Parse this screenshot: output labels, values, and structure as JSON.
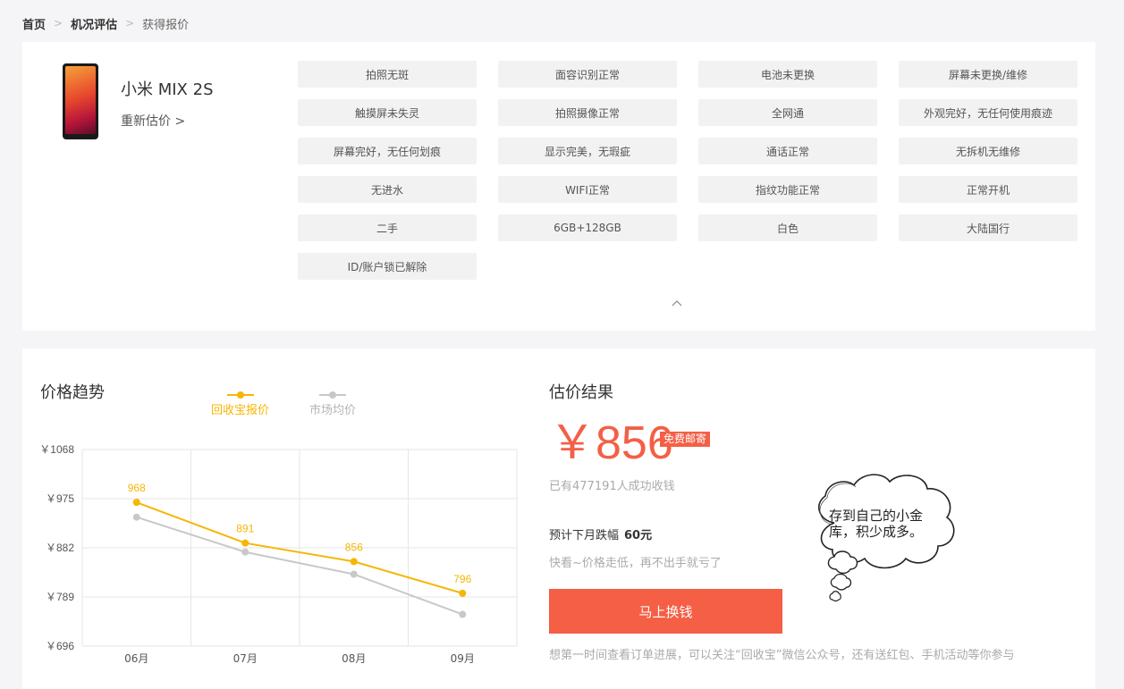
{
  "breadcrumb": {
    "home": "首页",
    "step2": "机况评估",
    "current": "获得报价"
  },
  "product": {
    "name": "小米 MIX 2S",
    "re_estimate": "重新估价 >"
  },
  "tags": [
    "拍照无斑",
    "面容识别正常",
    "电池未更换",
    "屏幕未更换/维修",
    "触摸屏未失灵",
    "拍照摄像正常",
    "全网通",
    "外观完好，无任何使用痕迹",
    "屏幕完好，无任何划痕",
    "显示完美，无瑕疵",
    "通话正常",
    "无拆机无维修",
    "无进水",
    "WIFI正常",
    "指纹功能正常",
    "正常开机",
    "二手",
    "6GB+128GB",
    "白色",
    "大陆国行",
    "ID/账户锁已解除"
  ],
  "trend": {
    "title": "价格趋势"
  },
  "colors": {
    "accent": "#f45f45",
    "series_ours": "#f6b604",
    "series_market": "#c8c8c8"
  },
  "chart_data": {
    "type": "line",
    "categories": [
      "06月",
      "07月",
      "08月",
      "09月"
    ],
    "ylim": [
      696,
      1068
    ],
    "yticks": [
      1068,
      975,
      882,
      789,
      696
    ],
    "ytick_labels": [
      "￥1068",
      "￥975",
      "￥882",
      "￥789",
      "￥696"
    ],
    "grid": true,
    "legend_position": "top",
    "series": [
      {
        "name": "回收宝报价",
        "values": [
          968,
          891,
          856,
          796
        ],
        "labels": [
          "968",
          "891",
          "856",
          "796"
        ]
      },
      {
        "name": "市场均价",
        "values": [
          940,
          874,
          832,
          756
        ]
      }
    ]
  },
  "result": {
    "title": "估价结果",
    "price": "￥856",
    "free_shipping": "免费邮寄",
    "success_count": "已有477191人成功收钱",
    "drop_label": "预计下月跌幅",
    "drop_amount": "60元",
    "drop_hint": "快看~价格走低，再不出手就亏了",
    "cta": "马上换钱",
    "follow_hint": "想第一时间查看订单进展，可以关注“回收宝”微信公众号，还有送红包、手机活动等你参与"
  },
  "bubble": {
    "text": "存到自己的小金库，积少成多。"
  }
}
